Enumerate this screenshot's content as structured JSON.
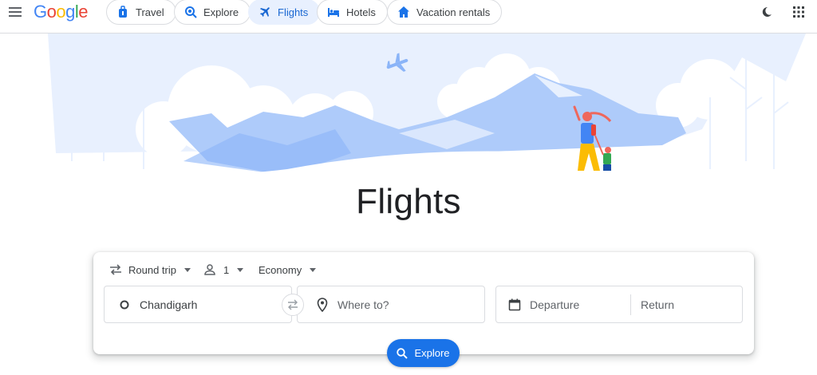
{
  "brand": {
    "letters": [
      "G",
      "o",
      "o",
      "g",
      "l",
      "e"
    ],
    "colors": [
      "#4285F4",
      "#EA4335",
      "#FBBC05",
      "#4285F4",
      "#34A853",
      "#EA4335"
    ]
  },
  "nav": {
    "tabs": [
      {
        "label": "Travel",
        "icon": "suitcase-icon"
      },
      {
        "label": "Explore",
        "icon": "explore-icon"
      },
      {
        "label": "Flights",
        "icon": "airplane-icon",
        "active": true
      },
      {
        "label": "Hotels",
        "icon": "bed-icon"
      },
      {
        "label": "Vacation rentals",
        "icon": "house-icon"
      }
    ]
  },
  "header_right": {
    "icons": [
      "dark-mode-icon",
      "apps-grid-icon"
    ]
  },
  "hero": {
    "title": "Flights"
  },
  "search": {
    "trip_type": "Round trip",
    "passengers": "1",
    "cabin_class": "Economy",
    "origin": "Chandigarh",
    "destination_placeholder": "Where to?",
    "departure_placeholder": "Departure",
    "return_placeholder": "Return",
    "explore_label": "Explore"
  },
  "colors": {
    "accent": "#1a73e8",
    "active_tab_bg": "#e8f0fe",
    "active_tab_text": "#1967d2",
    "sky": "#e8f0fe",
    "mountain": "#aecbfa"
  }
}
